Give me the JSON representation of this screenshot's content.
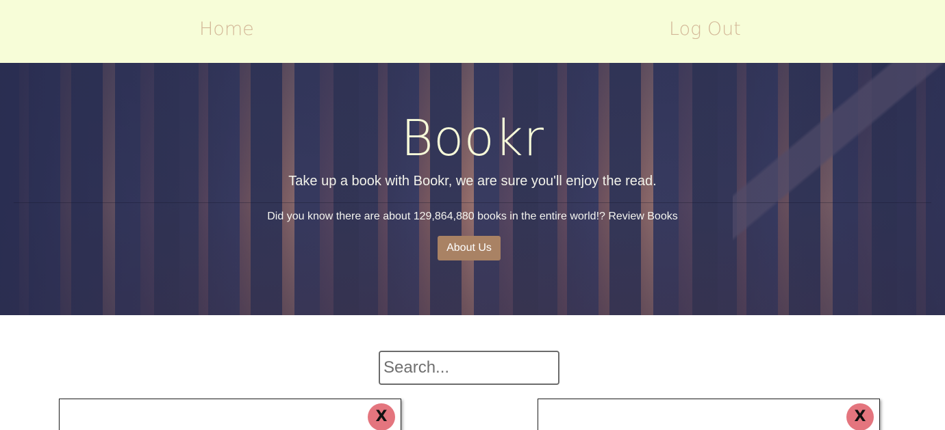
{
  "nav": {
    "home_label": "Home",
    "logout_label": "Log Out"
  },
  "hero": {
    "title": "Bookr",
    "subtitle": "Take up a book with Bookr, we are sure you'll enjoy the read.",
    "fact": "Did you know there are about 129,864,880 books in the entire world!? Review Books",
    "about_button": "About Us"
  },
  "search": {
    "placeholder": "Search...",
    "value": ""
  },
  "cards": [
    {
      "close_label": "X"
    },
    {
      "close_label": "X"
    }
  ],
  "colors": {
    "navbar_bg": "#f7fdd8",
    "nav_link": "#d3b797",
    "title": "#f7fbd9",
    "about_button_bg": "#a98264",
    "close_button_bg": "#e4757e"
  }
}
